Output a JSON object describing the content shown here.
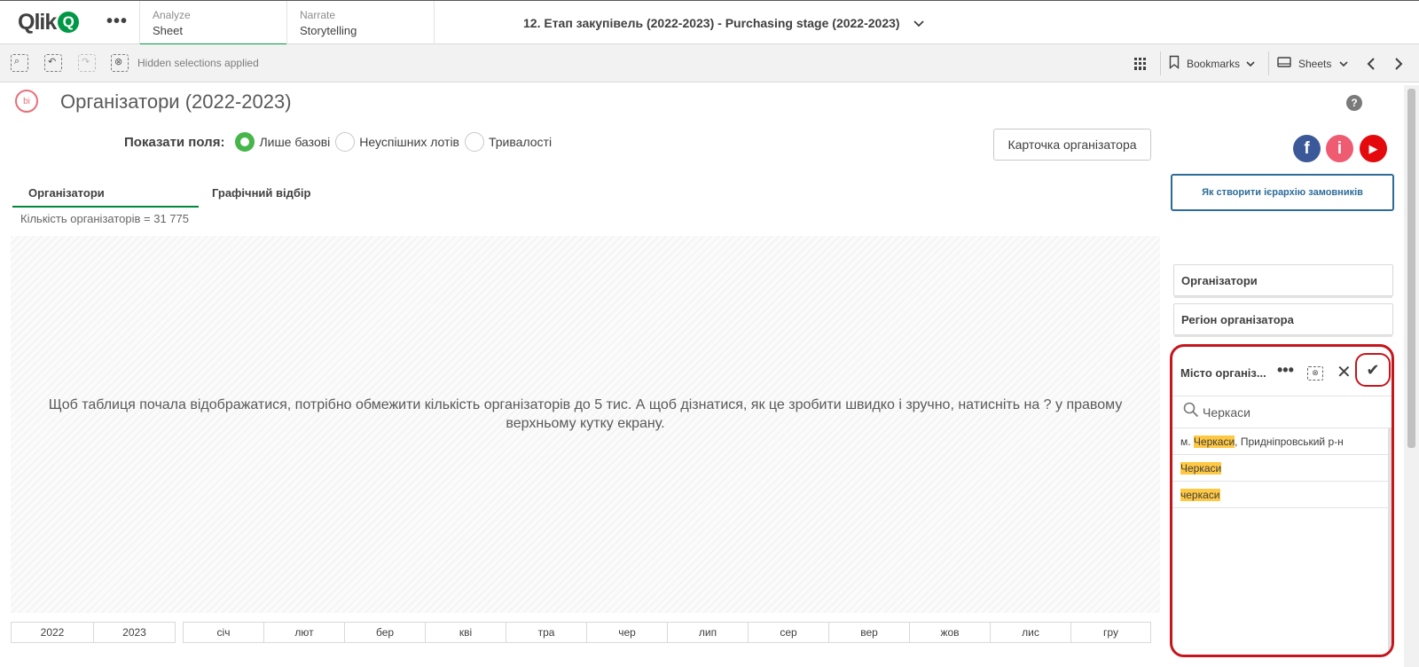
{
  "header": {
    "logo_text": "Qlik",
    "logo_q": "Q",
    "more": "•••",
    "analyze": {
      "small": "Analyze",
      "big": "Sheet"
    },
    "narrate": {
      "small": "Narrate",
      "big": "Storytelling"
    },
    "app_title": "12. Етап закупівель (2022-2023) - Purchasing stage (2022-2023)"
  },
  "toolbar": {
    "hidden_selections": "Hidden selections applied",
    "bookmarks": "Bookmarks",
    "sheets": "Sheets"
  },
  "sheet": {
    "title": "Організатори (2022-2023)",
    "icon_text": "bi",
    "help": "?"
  },
  "fields": {
    "label": "Показати поля:",
    "options": [
      "Лише базові",
      "Неуспішних лотів",
      "Тривалості"
    ],
    "selected": "Лише базові"
  },
  "card_button": "Карточка організатора",
  "social": {
    "fb": "f",
    "info": "i",
    "yt": "▶"
  },
  "container_tabs": [
    "Організатори",
    "Графічний відбір"
  ],
  "count_text": "Кількість організаторів = 31 775",
  "main_message_line1": "Щоб таблиця почала відображатися, потрібно обмежити кількість організаторів до 5 тис. А щоб дізнатися, як це зробити швидко і зручно, натисніть на ? у правому",
  "main_message_line2": "верхньому кутку екрану.",
  "years": [
    "2022",
    "2023"
  ],
  "months": [
    "січ",
    "лют",
    "бер",
    "кві",
    "тра",
    "чер",
    "лип",
    "сер",
    "вер",
    "жов",
    "лис",
    "гру"
  ],
  "right_panel": {
    "hierarchy_button": "Як створити ієрархію замовників",
    "filter_organizers": "Організатори",
    "filter_region": "Регіон організатора",
    "listbox": {
      "title": "Місто організ...",
      "search_value": "Черкаси",
      "rows": [
        {
          "pre": "м. ",
          "hl": "Черкаси",
          "post": ", Придніпровський р-н"
        },
        {
          "pre": "",
          "hl": "Черкаси",
          "post": ""
        },
        {
          "pre": "",
          "hl": "черкаси",
          "post": ""
        }
      ]
    }
  },
  "colors": {
    "qlik_green": "#009845",
    "radio_green": "#46b64a",
    "highlight_red": "#c4161c",
    "hierarchy_blue": "#2e6c98",
    "search_highlight": "#ffc843"
  }
}
